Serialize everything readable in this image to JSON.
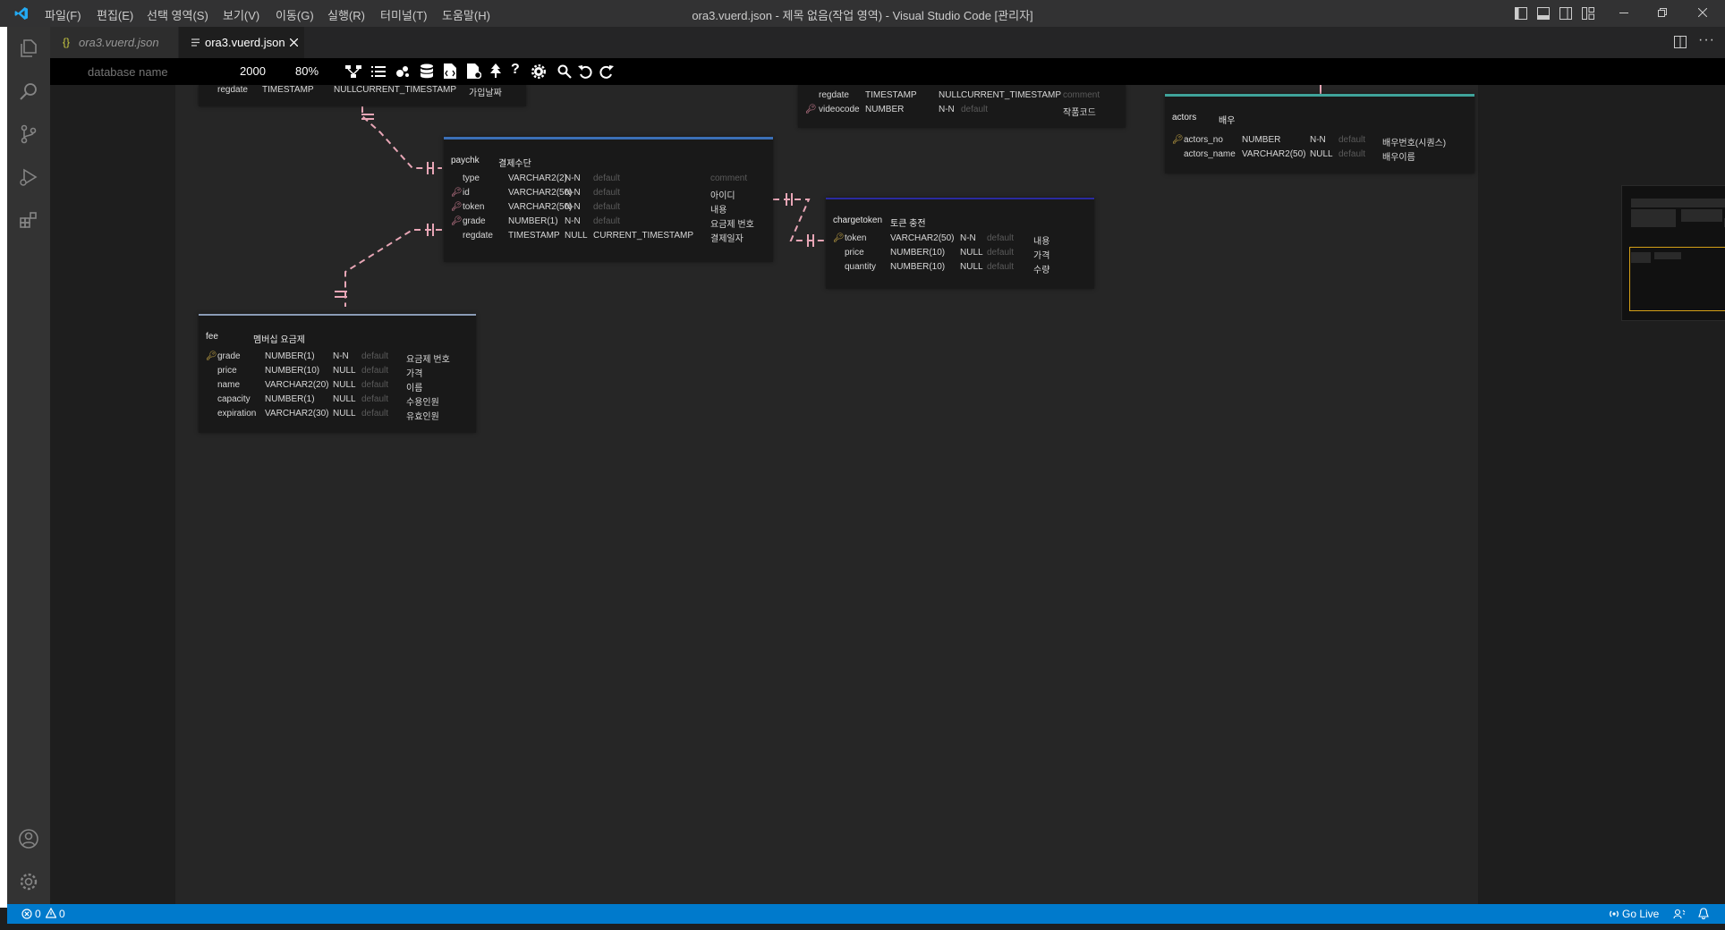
{
  "titlebar": {
    "menus": [
      "파일(F)",
      "편집(E)",
      "선택 영역(S)",
      "보기(V)",
      "이동(G)",
      "실행(R)",
      "터미널(T)",
      "도움말(H)"
    ],
    "title": "ora3.vuerd.json - 제목 없음(작업 영역) - Visual Studio Code [관리자]"
  },
  "tabs": [
    {
      "label": "ora3.vuerd.json",
      "icon": "json-braces-icon",
      "active": false
    },
    {
      "label": "ora3.vuerd.json",
      "icon": "file-lines-icon",
      "active": true
    }
  ],
  "toolbar": {
    "db_placeholder": "database name",
    "canvas_size": "2000",
    "zoom": "80%"
  },
  "tables": {
    "partial_top": {
      "row": {
        "name": "regdate",
        "type": "TIMESTAMP",
        "nn": "NULL",
        "def": "CURRENT_TIMESTAMP",
        "comment": "가입날짜"
      }
    },
    "partial_video": {
      "rows": [
        {
          "name": "regdate",
          "type": "TIMESTAMP",
          "nn": "NULL",
          "def": "CURRENT_TIMESTAMP",
          "comment": "comment"
        },
        {
          "name": "videocode",
          "type": "NUMBER",
          "nn": "N-N",
          "def": "default",
          "comment": "작품코드"
        }
      ]
    },
    "actors": {
      "name": "actors",
      "comment": "배우",
      "rows": [
        {
          "name": "actors_no",
          "type": "NUMBER",
          "nn": "N-N",
          "def": "default",
          "comment": "배우번호(시퀀스)"
        },
        {
          "name": "actors_name",
          "type": "VARCHAR2(50)",
          "nn": "NULL",
          "def": "default",
          "comment": "배우이름"
        }
      ]
    },
    "paychk": {
      "name": "paychk",
      "comment": "결제수단",
      "rows": [
        {
          "name": "type",
          "type": "VARCHAR2(2)",
          "nn": "N-N",
          "def": "default",
          "comment": "comment"
        },
        {
          "name": "id",
          "type": "VARCHAR2(50)",
          "nn": "N-N",
          "def": "default",
          "comment": "아이디"
        },
        {
          "name": "token",
          "type": "VARCHAR2(50)",
          "nn": "N-N",
          "def": "default",
          "comment": "내용"
        },
        {
          "name": "grade",
          "type": "NUMBER(1)",
          "nn": "N-N",
          "def": "default",
          "comment": "요금제 번호"
        },
        {
          "name": "regdate",
          "type": "TIMESTAMP",
          "nn": "NULL",
          "def": "CURRENT_TIMESTAMP",
          "comment": "결제일자"
        }
      ]
    },
    "chargetoken": {
      "name": "chargetoken",
      "comment": "토큰 충전",
      "rows": [
        {
          "name": "token",
          "type": "VARCHAR2(50)",
          "nn": "N-N",
          "def": "default",
          "comment": "내용"
        },
        {
          "name": "price",
          "type": "NUMBER(10)",
          "nn": "NULL",
          "def": "default",
          "comment": "가격"
        },
        {
          "name": "quantity",
          "type": "NUMBER(10)",
          "nn": "NULL",
          "def": "default",
          "comment": "수량"
        }
      ]
    },
    "fee": {
      "name": "fee",
      "comment": "멤버십 요금제",
      "rows": [
        {
          "name": "grade",
          "type": "NUMBER(1)",
          "nn": "N-N",
          "def": "default",
          "comment": "요금제 번호"
        },
        {
          "name": "price",
          "type": "NUMBER(10)",
          "nn": "NULL",
          "def": "default",
          "comment": "가격"
        },
        {
          "name": "name",
          "type": "VARCHAR2(20)",
          "nn": "NULL",
          "def": "default",
          "comment": "이름"
        },
        {
          "name": "capacity",
          "type": "NUMBER(1)",
          "nn": "NULL",
          "def": "default",
          "comment": "수용인원"
        },
        {
          "name": "expiration",
          "type": "VARCHAR2(30)",
          "nn": "NULL",
          "def": "default",
          "comment": "유효인원"
        }
      ]
    }
  },
  "statusbar": {
    "errors": "0",
    "warnings": "0",
    "golive": "Go Live"
  },
  "colors": {
    "accent": "#007acc",
    "paychk_bar": "#3b6fb6",
    "chargetoken_bar": "#2a2aa0",
    "actors_bar": "#3fa39a",
    "relation_line": "#e8a6b6"
  }
}
